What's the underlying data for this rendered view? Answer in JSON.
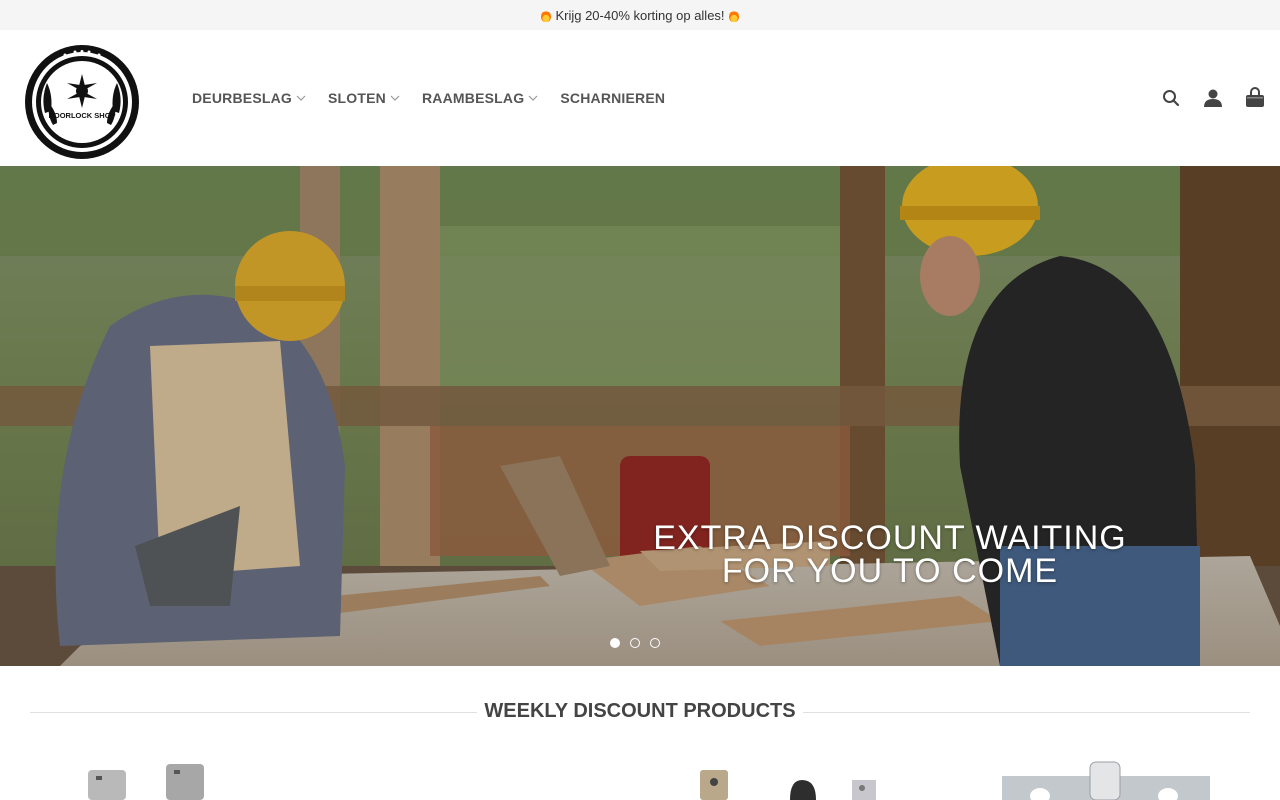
{
  "promo": {
    "text": "Krijg 20-40% korting op alles!"
  },
  "logo": {
    "text": "DOORLOCK SHOP"
  },
  "nav": {
    "items": [
      {
        "label": "DEURBESLAG",
        "has_dropdown": true
      },
      {
        "label": "SLOTEN",
        "has_dropdown": true
      },
      {
        "label": "RAAMBESLAG",
        "has_dropdown": true
      },
      {
        "label": "SCHARNIEREN",
        "has_dropdown": false
      }
    ]
  },
  "header_icons": [
    "search-icon",
    "account-icon",
    "cart-icon"
  ],
  "hero": {
    "line1": "EXTRA DISCOUNT WAITING",
    "line2": "FOR YOU TO COME",
    "slides": 3,
    "active_slide": 1
  },
  "section": {
    "title": "WEEKLY DISCOUNT PRODUCTS"
  },
  "colors": {
    "promo_bg": "#f5f5f5",
    "nav_text": "#555555",
    "hero_text": "#ffffff"
  }
}
